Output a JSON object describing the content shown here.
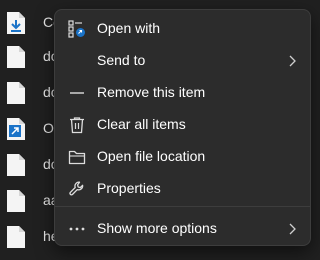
{
  "background_files": [
    {
      "label": "Co",
      "icon": "download-file-icon"
    },
    {
      "label": "do",
      "icon": "file-icon"
    },
    {
      "label": "do",
      "icon": "file-icon"
    },
    {
      "label": "O",
      "icon": "shortcut-file-icon"
    },
    {
      "label": "do",
      "icon": "file-icon"
    },
    {
      "label": "aa",
      "icon": "file-icon"
    },
    {
      "label": "he",
      "icon": "file-icon"
    }
  ],
  "context_menu": {
    "items": [
      {
        "label": "Open with",
        "icon": "open-with-icon"
      },
      {
        "label": "Send to",
        "icon": "none",
        "has_submenu": true
      },
      {
        "label": "Remove this item",
        "icon": "dash-icon"
      },
      {
        "label": "Clear all items",
        "icon": "trash-icon"
      },
      {
        "label": "Open file location",
        "icon": "folder-icon"
      },
      {
        "label": "Properties",
        "icon": "wrench-icon"
      }
    ],
    "more": {
      "label": "Show more options",
      "icon": "ellipsis-icon",
      "has_submenu": true
    }
  },
  "colors": {
    "menu_bg": "#2c2c2c",
    "page_bg": "#202020",
    "text": "#ffffff",
    "accent": "#1a73c8"
  }
}
